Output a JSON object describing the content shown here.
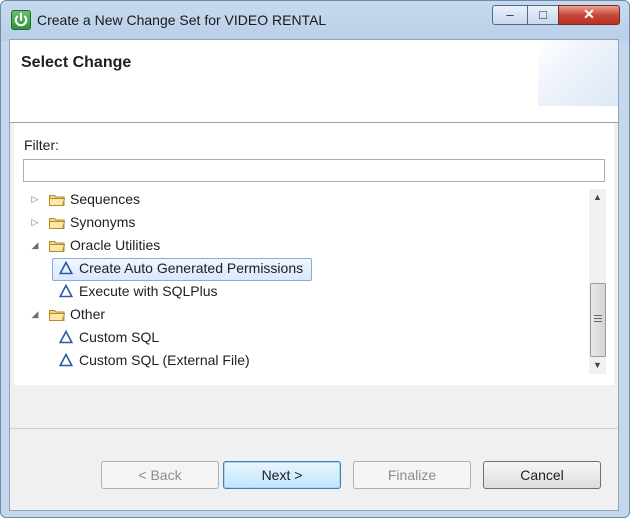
{
  "window": {
    "title": "Create a New Change Set for VIDEO RENTAL",
    "controls": {
      "minimize": "–",
      "maximize": "□",
      "close": "✕"
    }
  },
  "banner": {
    "title": "Select Change"
  },
  "filter": {
    "label": "Filter:",
    "value": "",
    "placeholder": ""
  },
  "tree": {
    "items": [
      {
        "label": "Sequences",
        "type": "folder",
        "expanded": false,
        "level": 0
      },
      {
        "label": "Synonyms",
        "type": "folder",
        "expanded": false,
        "level": 0
      },
      {
        "label": "Oracle Utilities",
        "type": "folder",
        "expanded": true,
        "level": 0
      },
      {
        "label": "Create Auto Generated Permissions",
        "type": "change",
        "level": 1,
        "selected": true
      },
      {
        "label": "Execute with SQLPlus",
        "type": "change",
        "level": 1
      },
      {
        "label": "Other",
        "type": "folder",
        "expanded": true,
        "level": 0
      },
      {
        "label": "Custom SQL",
        "type": "change",
        "level": 1
      },
      {
        "label": "Custom SQL (External File)",
        "type": "change",
        "level": 1
      }
    ]
  },
  "buttons": {
    "back": "< Back",
    "next": "Next >",
    "finalize": "Finalize",
    "cancel": "Cancel"
  },
  "colors": {
    "selection": "#d9e8fb",
    "accent": "#3c7fb1",
    "delta_icon": "#2d5aa0",
    "folder": "#e8c15c"
  }
}
